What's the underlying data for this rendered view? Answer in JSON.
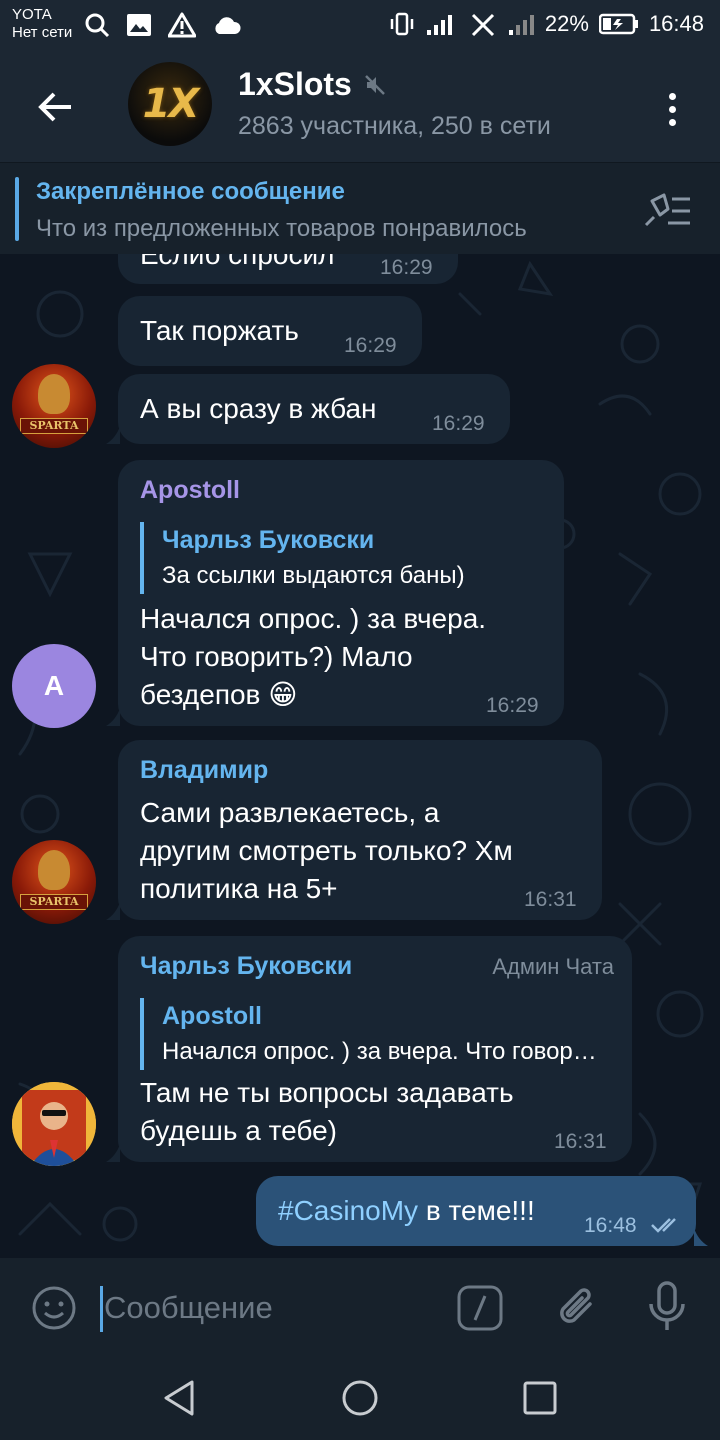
{
  "status_bar": {
    "carrier": "YOTA",
    "carrier_sub": "Нет сети",
    "battery": "22%",
    "time": "16:48"
  },
  "header": {
    "avatar_text": "1X",
    "title": "1xSlots",
    "subtitle": "2863 участника, 250 в сети"
  },
  "pinned": {
    "title": "Закреплённое сообщение",
    "text": "Что из предложенных товаров понравилось"
  },
  "messages": [
    {
      "text": "Еслиб спросил",
      "time": "16:29"
    },
    {
      "text": "Так поржать",
      "time": "16:29"
    },
    {
      "text": "А вы сразу в жбан",
      "time": "16:29",
      "avatar_text": "SPARTA"
    },
    {
      "sender": "Apostoll",
      "sender_color": "#a695e7",
      "reply_name": "Чарльз Буковски",
      "reply_text": "За ссылки выдаются баны)",
      "lines": [
        "Начался опрос. ) за вчера.",
        "Что говорить?) Мало",
        "бездепов 😁"
      ],
      "time": "16:29",
      "avatar_letter": "A"
    },
    {
      "sender": "Владимир",
      "sender_color": "#64b5ef",
      "lines": [
        "Сами развлекаетесь, а",
        "другим смотреть только? Хм",
        "политика на 5+"
      ],
      "time": "16:31",
      "avatar_text": "SPARTA"
    },
    {
      "sender": "Чарльз Буковски",
      "sender_color": "#64b5ef",
      "badge": "Админ Чата",
      "reply_name": "Apostoll",
      "reply_text": "Начался опрос. ) за вчера. Что говорить?) Мало бездепов",
      "lines": [
        "Там не ты вопросы задавать",
        "будешь а тебе)"
      ],
      "time": "16:31"
    }
  ],
  "outgoing": {
    "hashtag": "#CasinoMy",
    "text": " в теме!!!",
    "time": "16:48"
  },
  "input": {
    "placeholder": "Сообщение"
  },
  "colors": {
    "bg": "#0e1621",
    "header": "#1c2733",
    "bubble_in": "#182533",
    "bubble_out": "#2b5278",
    "accent": "#64b5ef"
  }
}
